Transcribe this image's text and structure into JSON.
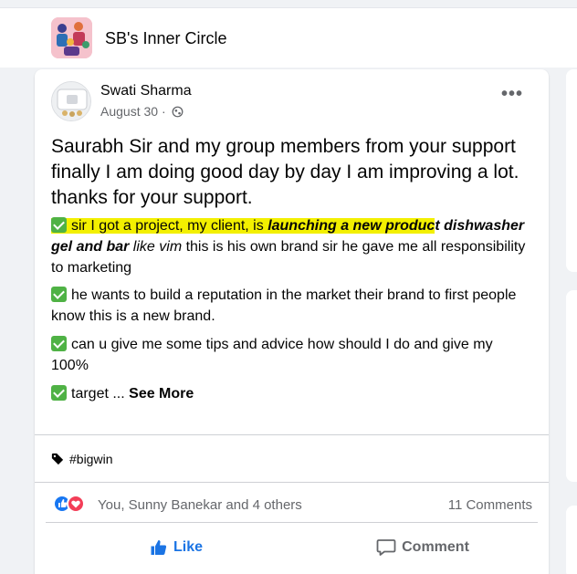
{
  "group": {
    "name": "SB's Inner Circle",
    "avatar_icon": "group-photo-icon"
  },
  "post": {
    "author": "Swati Sharma",
    "date": "August 30",
    "separator": " · ",
    "privacy_icon": "globe-icon",
    "menu_icon": "more-options-icon",
    "headline": "Saurabh Sir and my group members from your support finally I am doing good day by day I am improving a lot. thanks for your support.",
    "p1": {
      "highlighted": "sir I got a project, my client, is ",
      "highlighted_bold_italic": "launching a new produc",
      "bold_italic_tail": "t",
      "bold_italic_2": "dishwasher gel and bar",
      "italic": " like vim",
      "rest": " this is his own brand sir he gave me all responsibility to marketing"
    },
    "p2": "he wants to build a reputation in the market their brand to first people know this is a new brand.",
    "p3": "can u give me some tips and advice how should I do and give my 100%",
    "p4": "target ... ",
    "see_more": "See More",
    "hashtag": "#bigwin",
    "tag_icon": "tag-icon",
    "reactions_text": "You, Sunny Banekar and 4 others",
    "comments_text": "11 Comments",
    "like_label": "Like",
    "comment_label": "Comment"
  },
  "colors": {
    "accent": "#1b74e4",
    "highlight": "#f3f000",
    "check": "#4fb245",
    "love": "#f33e58"
  }
}
